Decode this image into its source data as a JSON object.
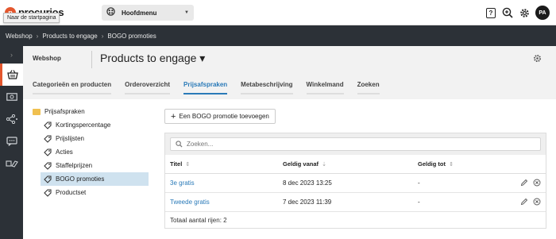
{
  "topbar": {
    "logo_mark": "p",
    "logo_text": "procurios",
    "tooltip": "Naar de startpagina",
    "main_menu_label": "Hoofdmenu",
    "help_label": "?",
    "avatar_initials": "PA"
  },
  "breadcrumb": [
    "Webshop",
    "Products to engage",
    "BOGO promoties"
  ],
  "breadcrumb_sep": "›",
  "header": {
    "shop_label": "Webshop",
    "title": "Products to engage ▾",
    "tabs": [
      {
        "label": "Categorieën en producten"
      },
      {
        "label": "Orderoverzicht"
      },
      {
        "label": "Prijsafspraken"
      },
      {
        "label": "Metabeschrijving"
      },
      {
        "label": "Winkelmand"
      },
      {
        "label": "Zoeken"
      }
    ]
  },
  "tree": {
    "root_label": "Prijsafspraken",
    "items": [
      {
        "label": "Kortingspercentage"
      },
      {
        "label": "Prijslijsten"
      },
      {
        "label": "Acties"
      },
      {
        "label": "Staffelprijzen"
      },
      {
        "label": "BOGO promoties"
      },
      {
        "label": "Productset"
      }
    ]
  },
  "content": {
    "add_button_label": "Een BOGO promotie toevoegen",
    "search_placeholder": "Zoeken...",
    "columns": [
      {
        "label": "Titel",
        "sort": "⇕"
      },
      {
        "label": "Geldig vanaf",
        "sort": "⇣"
      },
      {
        "label": "Geldig tot",
        "sort": "⇕"
      }
    ],
    "rows": [
      {
        "title": "3e gratis",
        "from": "8 dec 2023 13:25",
        "to": "-"
      },
      {
        "title": "Tweede gratis",
        "from": "7 dec 2023 11:39",
        "to": "-"
      }
    ],
    "footer": "Totaal aantal rijen: 2"
  },
  "colors": {
    "accent": "#e4572e",
    "link": "#2a7ab8",
    "dark_bar": "#2c3137"
  }
}
